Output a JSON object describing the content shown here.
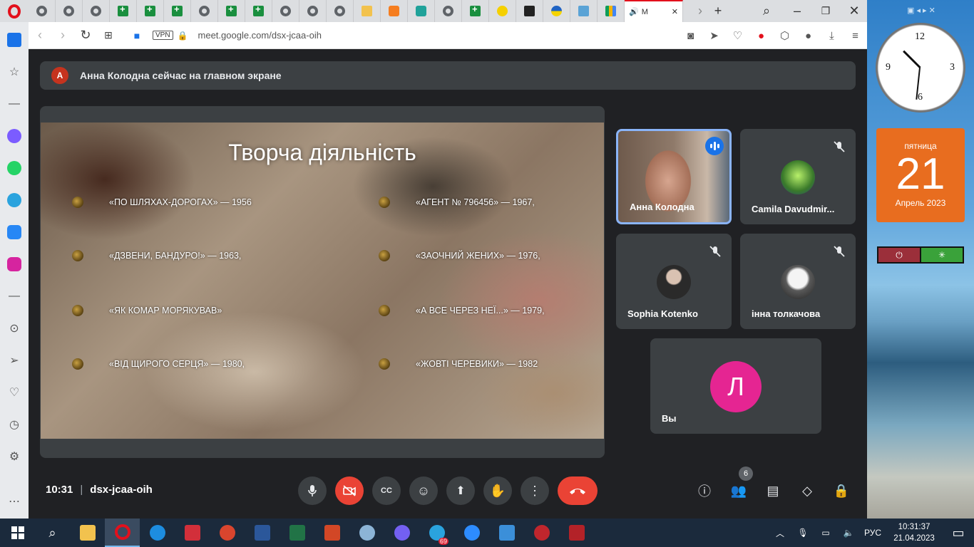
{
  "browser": {
    "active_tab_label": "M",
    "url": "meet.google.com/dsx-jcaa-oih",
    "vpn_label": "VPN"
  },
  "meet": {
    "banner_initial": "А",
    "banner_text": "Анна Колодна сейчас на главном экране",
    "slide": {
      "title": "Творча діяльність",
      "items_left": [
        "«ПО ШЛЯХАХ-ДОРОГАХ» — 1956",
        "«ДЗВЕНИ, БАНДУРО!» — 1963,",
        "«ЯК КОМАР МОРЯКУВАВ»",
        "«ВІД ЩИРОГО СЕРЦЯ» — 1980,"
      ],
      "items_right": [
        "«АГЕНТ № 796456» — 1967,",
        "«ЗАОЧНИЙ ЖЕНИХ» — 1976,",
        "«А ВСЕ ЧЕРЕЗ НЕЇ...» — 1979,",
        "«ЖОВТІ ЧЕРЕВИКИ» — 1982"
      ]
    },
    "participants": [
      {
        "name": "Анна Колодна"
      },
      {
        "name": "Camila Davudmir..."
      },
      {
        "name": "Sophia Kotenko"
      },
      {
        "name": "інна толкачова"
      }
    ],
    "self": {
      "initial": "Л",
      "name": "Вы"
    },
    "time": "10:31",
    "meeting_code": "dsx-jcaa-oih",
    "participant_count": "6"
  },
  "desktop": {
    "weekday": "пятница",
    "day": "21",
    "month_year": "Апрель 2023"
  },
  "taskbar": {
    "lang": "РУС",
    "time": "10:31:37",
    "date": "21.04.2023",
    "telegram_badge": "69"
  },
  "colors": {
    "meet_bg": "#202124",
    "tile_bg": "#3c4043",
    "end_call": "#ea4335",
    "speaking_border": "#8ab4f8",
    "self_avatar": "#e52592",
    "calendar": "#e86d1f"
  }
}
